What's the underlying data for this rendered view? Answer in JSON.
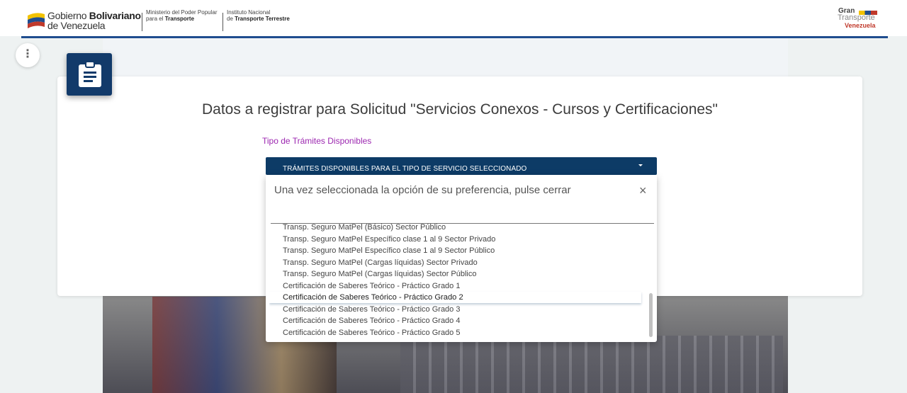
{
  "header": {
    "gov_name_line1_a": "Gobierno ",
    "gov_name_line1_b": "Bolivariano",
    "gov_name_line2": "de Venezuela",
    "ministry_line1": "Ministerio del Poder Popular",
    "ministry_line2_a": "para el ",
    "ministry_line2_b": "Transporte",
    "institute_line1": "Instituto Nacional",
    "institute_line2_a": "de ",
    "institute_line2_b": "Transporte Terrestre",
    "gm_logo_line1": "Gran",
    "gm_logo_line2": "Transporte",
    "gm_logo_line3": "Venezuela",
    "accent_color": "#1f4d8f"
  },
  "menu_button": {
    "label": "⋮"
  },
  "card": {
    "icon": "clipboard-icon",
    "title": "Datos a registrar para Solicitud \"Servicios Conexos - Cursos y Certificaciones\"",
    "field_label": "Tipo de Trámites Disponibles"
  },
  "select": {
    "value": "TRÁMITES DISPONIBLES PARA EL TIPO DE SERVICIO SELECCIONADO"
  },
  "dropdown": {
    "header": "Una vez seleccionada la opción de su preferencia, pulse cerrar",
    "close_label": "×",
    "search_value": "",
    "items": [
      "Transp. Seguro MatPel (Básico) Sector Público",
      "Transp. Seguro MatPel Específico clase 1 al 9 Sector Privado",
      "Transp. Seguro MatPel Específico clase 1 al 9 Sector Público",
      "Transp. Seguro MatPel (Cargas líquidas) Sector Privado",
      "Transp. Seguro MatPel (Cargas líquidas) Sector Público",
      "Certificación de Saberes Teórico - Práctico Grado 1",
      "Certificación de Saberes Teórico - Práctico Grado 2",
      "Certificación de Saberes Teórico - Práctico Grado 3",
      "Certificación de Saberes Teórico - Práctico Grado 4",
      "Certificación de Saberes Teórico - Práctico Grado 5"
    ],
    "active_item": "Certificación de Saberes Teórico - Práctico Grado 2"
  }
}
